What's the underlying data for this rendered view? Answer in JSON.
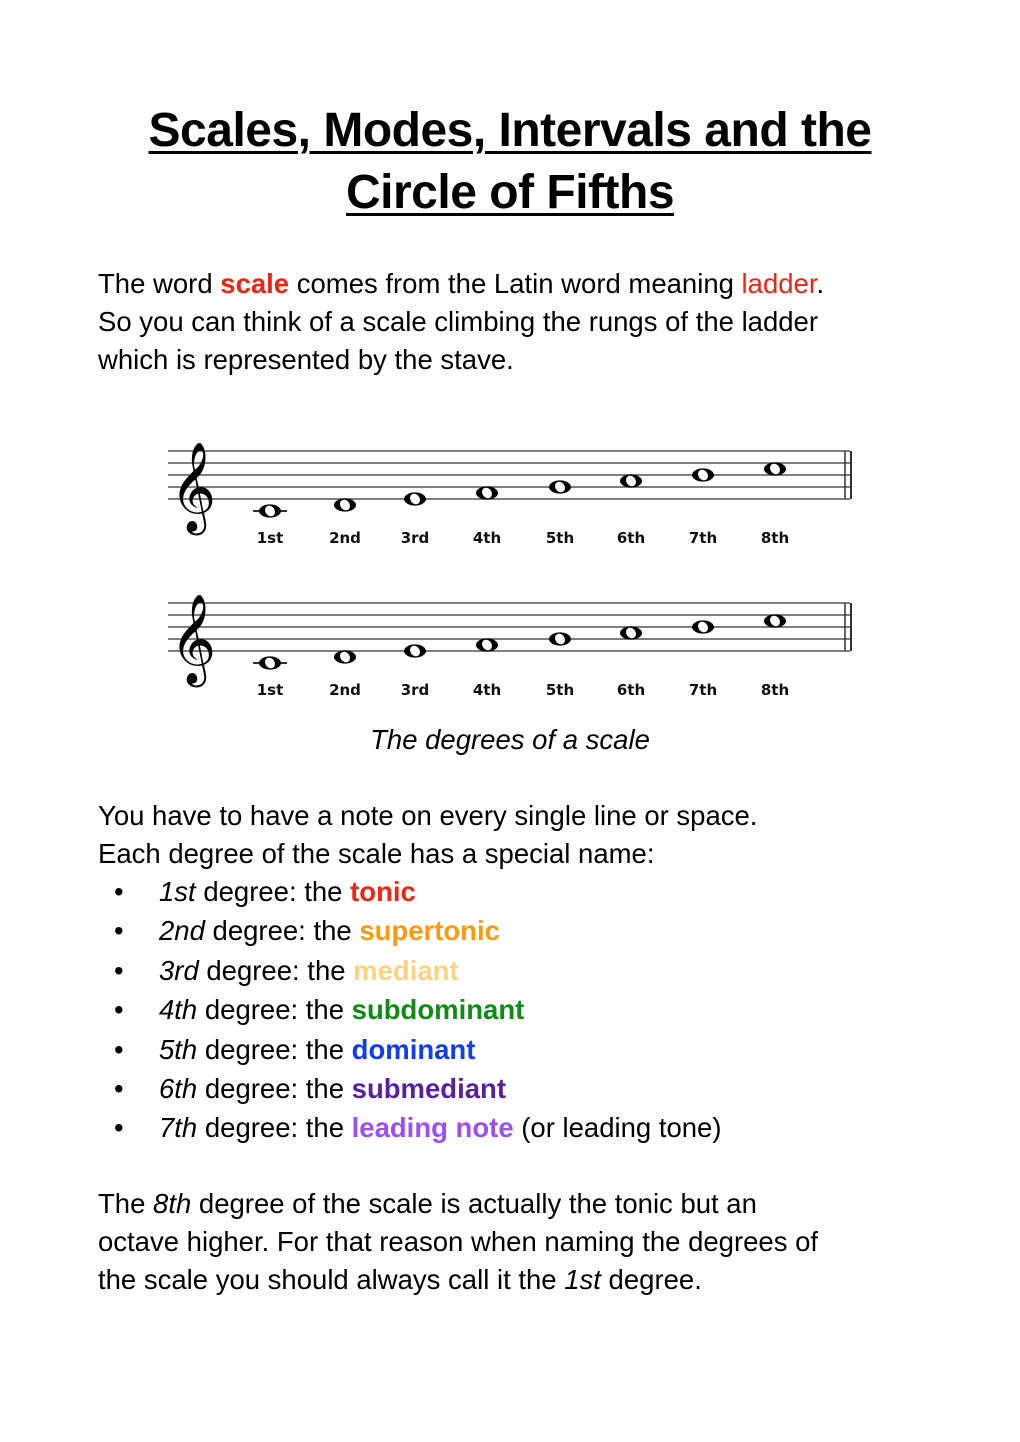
{
  "title": {
    "line1": "Scales, Modes, Intervals and the",
    "line2": "Circle of Fifths"
  },
  "intro": {
    "t1": "The word ",
    "scale_word": "scale",
    "t2": " comes from the Latin word meaning ",
    "ladder_word": "ladder",
    "t3": ".",
    "line2": "So you can think of a scale climbing the rungs of the ladder",
    "line3": "which is represented by the stave."
  },
  "figure": {
    "staves": [
      {
        "clef": "treble-clef",
        "notes": [
          "C4",
          "D4",
          "E4",
          "F4",
          "G4",
          "A4",
          "B4",
          "C5"
        ],
        "labels": [
          "1st",
          "2nd",
          "3rd",
          "4th",
          "5th",
          "6th",
          "7th",
          "8th"
        ]
      },
      {
        "clef": "treble-clef",
        "notes": [
          "C4",
          "D4",
          "E4",
          "F4",
          "G4",
          "A4",
          "B4",
          "C5"
        ],
        "labels": [
          "1st",
          "2nd",
          "3rd",
          "4th",
          "5th",
          "6th",
          "7th",
          "8th"
        ]
      }
    ],
    "caption": "The degrees of a scale"
  },
  "section2": {
    "line1": "You have to have a note on every single line or space.",
    "line2": "Each degree of the scale has a special name:"
  },
  "degrees": [
    {
      "bullet": "•",
      "ordinal": "1st",
      "mid": " degree: the ",
      "name": "tonic",
      "color": "#f0250f",
      "suffix": ""
    },
    {
      "bullet": "•",
      "ordinal": "2nd",
      "mid": " degree: the ",
      "name": "supertonic",
      "color": "#fb9a0e",
      "suffix": ""
    },
    {
      "bullet": "•",
      "ordinal": "3rd",
      "mid": " degree: the ",
      "name": "mediant",
      "color": "#fdd37d",
      "suffix": ""
    },
    {
      "bullet": "•",
      "ordinal": "4th",
      "mid": " degree: the ",
      "name": "subdominant",
      "color": "#0e8c14",
      "suffix": ""
    },
    {
      "bullet": "•",
      "ordinal": "5th",
      "mid": " degree: the ",
      "name": "dominant",
      "color": "#0d3df5",
      "suffix": ""
    },
    {
      "bullet": "•",
      "ordinal": "6th",
      "mid": " degree: the ",
      "name": "submediant",
      "color": "#5a1f9e",
      "suffix": ""
    },
    {
      "bullet": "•",
      "ordinal": "7th",
      "mid": " degree: the ",
      "name": "leading note",
      "color": "#9b4ff5",
      "suffix": " (or leading tone)"
    }
  ],
  "closing": {
    "l1a": "The ",
    "l1i": "8th",
    "l1b": " degree of the scale is actually the tonic but an",
    "l2": "octave higher. For that reason when naming the degrees of",
    "l3a": "the scale you should always call it the ",
    "l3i": "1st",
    "l3b": " degree."
  }
}
